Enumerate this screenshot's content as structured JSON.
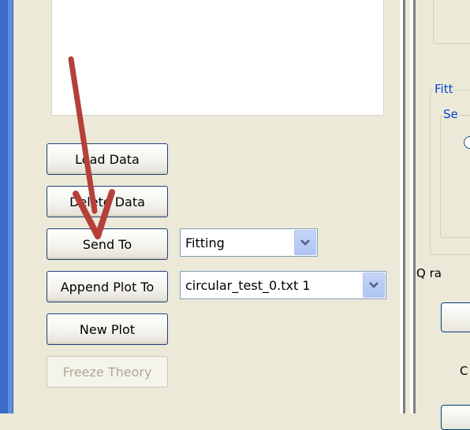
{
  "buttons": {
    "load_data": "Load Data",
    "delete_data": "Delete Data",
    "send_to": "Send To",
    "append_plot_to": "Append Plot To",
    "new_plot": "New Plot",
    "freeze_theory": "Freeze Theory"
  },
  "combos": {
    "send_to_value": "Fitting",
    "append_plot_value": "circular_test_0.txt 1"
  },
  "right_panel": {
    "fitting_legend": "Fitt",
    "sub_legend": "Se",
    "q_range_label": "Q ra",
    "c_label": "C"
  },
  "icons": {
    "combo_dropdown": "chevron-down-icon",
    "annotation": "red-arrow-annotation"
  },
  "colors": {
    "annotation_arrow": "#b5403a",
    "legend_text": "#0046d5"
  }
}
